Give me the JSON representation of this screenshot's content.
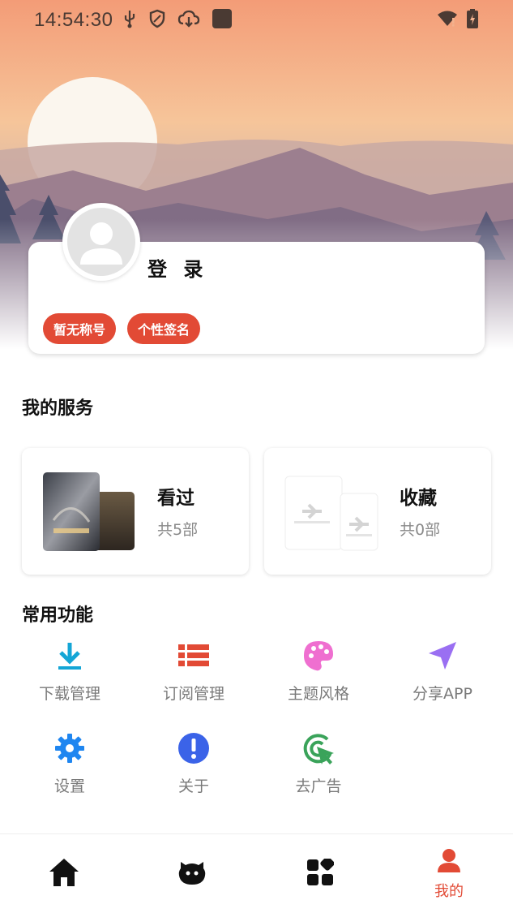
{
  "status_bar": {
    "time": "14:54:30",
    "icons": [
      "usb-icon",
      "shield-icon",
      "cloud-download-icon",
      "app-square-icon",
      "wifi-icon",
      "battery-icon"
    ]
  },
  "profile": {
    "login_label": "登 录",
    "tags": [
      "暂无称号",
      "个性签名"
    ]
  },
  "services": {
    "title": "我的服务",
    "cards": [
      {
        "title": "看过",
        "count": "共5部"
      },
      {
        "title": "收藏",
        "count": "共0部"
      }
    ]
  },
  "functions": {
    "title": "常用功能",
    "items": [
      {
        "label": "下载管理",
        "icon": "download-icon",
        "color": "#14a6d6"
      },
      {
        "label": "订阅管理",
        "icon": "list-icon",
        "color": "#e24a35"
      },
      {
        "label": "主题风格",
        "icon": "palette-icon",
        "color": "#ef6fd0"
      },
      {
        "label": "分享APP",
        "icon": "send-icon",
        "color": "#9a6ff2"
      },
      {
        "label": "设置",
        "icon": "gear-icon",
        "color": "#1f86f0"
      },
      {
        "label": "关于",
        "icon": "info-icon",
        "color": "#3b63e8"
      },
      {
        "label": "去广告",
        "icon": "cursor-click-icon",
        "color": "#3aa35a"
      }
    ]
  },
  "bottom_nav": {
    "items": [
      {
        "icon": "home-icon",
        "label": ""
      },
      {
        "icon": "mascot-icon",
        "label": ""
      },
      {
        "icon": "apps-icon",
        "label": ""
      },
      {
        "icon": "user-icon",
        "label": "我的"
      }
    ],
    "active_index": 3,
    "active_color": "#e24a35"
  }
}
